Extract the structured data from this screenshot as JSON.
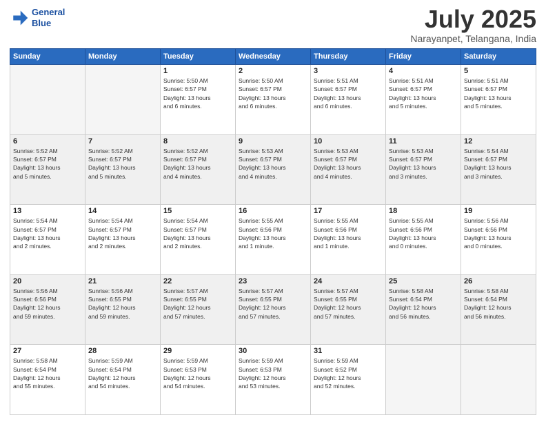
{
  "header": {
    "logo_line1": "General",
    "logo_line2": "Blue",
    "month": "July 2025",
    "location": "Narayanpet, Telangana, India"
  },
  "days_of_week": [
    "Sunday",
    "Monday",
    "Tuesday",
    "Wednesday",
    "Thursday",
    "Friday",
    "Saturday"
  ],
  "weeks": [
    [
      {
        "day": "",
        "info": ""
      },
      {
        "day": "",
        "info": ""
      },
      {
        "day": "1",
        "info": "Sunrise: 5:50 AM\nSunset: 6:57 PM\nDaylight: 13 hours\nand 6 minutes."
      },
      {
        "day": "2",
        "info": "Sunrise: 5:50 AM\nSunset: 6:57 PM\nDaylight: 13 hours\nand 6 minutes."
      },
      {
        "day": "3",
        "info": "Sunrise: 5:51 AM\nSunset: 6:57 PM\nDaylight: 13 hours\nand 6 minutes."
      },
      {
        "day": "4",
        "info": "Sunrise: 5:51 AM\nSunset: 6:57 PM\nDaylight: 13 hours\nand 5 minutes."
      },
      {
        "day": "5",
        "info": "Sunrise: 5:51 AM\nSunset: 6:57 PM\nDaylight: 13 hours\nand 5 minutes."
      }
    ],
    [
      {
        "day": "6",
        "info": "Sunrise: 5:52 AM\nSunset: 6:57 PM\nDaylight: 13 hours\nand 5 minutes."
      },
      {
        "day": "7",
        "info": "Sunrise: 5:52 AM\nSunset: 6:57 PM\nDaylight: 13 hours\nand 5 minutes."
      },
      {
        "day": "8",
        "info": "Sunrise: 5:52 AM\nSunset: 6:57 PM\nDaylight: 13 hours\nand 4 minutes."
      },
      {
        "day": "9",
        "info": "Sunrise: 5:53 AM\nSunset: 6:57 PM\nDaylight: 13 hours\nand 4 minutes."
      },
      {
        "day": "10",
        "info": "Sunrise: 5:53 AM\nSunset: 6:57 PM\nDaylight: 13 hours\nand 4 minutes."
      },
      {
        "day": "11",
        "info": "Sunrise: 5:53 AM\nSunset: 6:57 PM\nDaylight: 13 hours\nand 3 minutes."
      },
      {
        "day": "12",
        "info": "Sunrise: 5:54 AM\nSunset: 6:57 PM\nDaylight: 13 hours\nand 3 minutes."
      }
    ],
    [
      {
        "day": "13",
        "info": "Sunrise: 5:54 AM\nSunset: 6:57 PM\nDaylight: 13 hours\nand 2 minutes."
      },
      {
        "day": "14",
        "info": "Sunrise: 5:54 AM\nSunset: 6:57 PM\nDaylight: 13 hours\nand 2 minutes."
      },
      {
        "day": "15",
        "info": "Sunrise: 5:54 AM\nSunset: 6:57 PM\nDaylight: 13 hours\nand 2 minutes."
      },
      {
        "day": "16",
        "info": "Sunrise: 5:55 AM\nSunset: 6:56 PM\nDaylight: 13 hours\nand 1 minute."
      },
      {
        "day": "17",
        "info": "Sunrise: 5:55 AM\nSunset: 6:56 PM\nDaylight: 13 hours\nand 1 minute."
      },
      {
        "day": "18",
        "info": "Sunrise: 5:55 AM\nSunset: 6:56 PM\nDaylight: 13 hours\nand 0 minutes."
      },
      {
        "day": "19",
        "info": "Sunrise: 5:56 AM\nSunset: 6:56 PM\nDaylight: 13 hours\nand 0 minutes."
      }
    ],
    [
      {
        "day": "20",
        "info": "Sunrise: 5:56 AM\nSunset: 6:56 PM\nDaylight: 12 hours\nand 59 minutes."
      },
      {
        "day": "21",
        "info": "Sunrise: 5:56 AM\nSunset: 6:55 PM\nDaylight: 12 hours\nand 59 minutes."
      },
      {
        "day": "22",
        "info": "Sunrise: 5:57 AM\nSunset: 6:55 PM\nDaylight: 12 hours\nand 57 minutes."
      },
      {
        "day": "23",
        "info": "Sunrise: 5:57 AM\nSunset: 6:55 PM\nDaylight: 12 hours\nand 57 minutes."
      },
      {
        "day": "24",
        "info": "Sunrise: 5:57 AM\nSunset: 6:55 PM\nDaylight: 12 hours\nand 57 minutes."
      },
      {
        "day": "25",
        "info": "Sunrise: 5:58 AM\nSunset: 6:54 PM\nDaylight: 12 hours\nand 56 minutes."
      },
      {
        "day": "26",
        "info": "Sunrise: 5:58 AM\nSunset: 6:54 PM\nDaylight: 12 hours\nand 56 minutes."
      }
    ],
    [
      {
        "day": "27",
        "info": "Sunrise: 5:58 AM\nSunset: 6:54 PM\nDaylight: 12 hours\nand 55 minutes."
      },
      {
        "day": "28",
        "info": "Sunrise: 5:59 AM\nSunset: 6:54 PM\nDaylight: 12 hours\nand 54 minutes."
      },
      {
        "day": "29",
        "info": "Sunrise: 5:59 AM\nSunset: 6:53 PM\nDaylight: 12 hours\nand 54 minutes."
      },
      {
        "day": "30",
        "info": "Sunrise: 5:59 AM\nSunset: 6:53 PM\nDaylight: 12 hours\nand 53 minutes."
      },
      {
        "day": "31",
        "info": "Sunrise: 5:59 AM\nSunset: 6:52 PM\nDaylight: 12 hours\nand 52 minutes."
      },
      {
        "day": "",
        "info": ""
      },
      {
        "day": "",
        "info": ""
      }
    ]
  ]
}
